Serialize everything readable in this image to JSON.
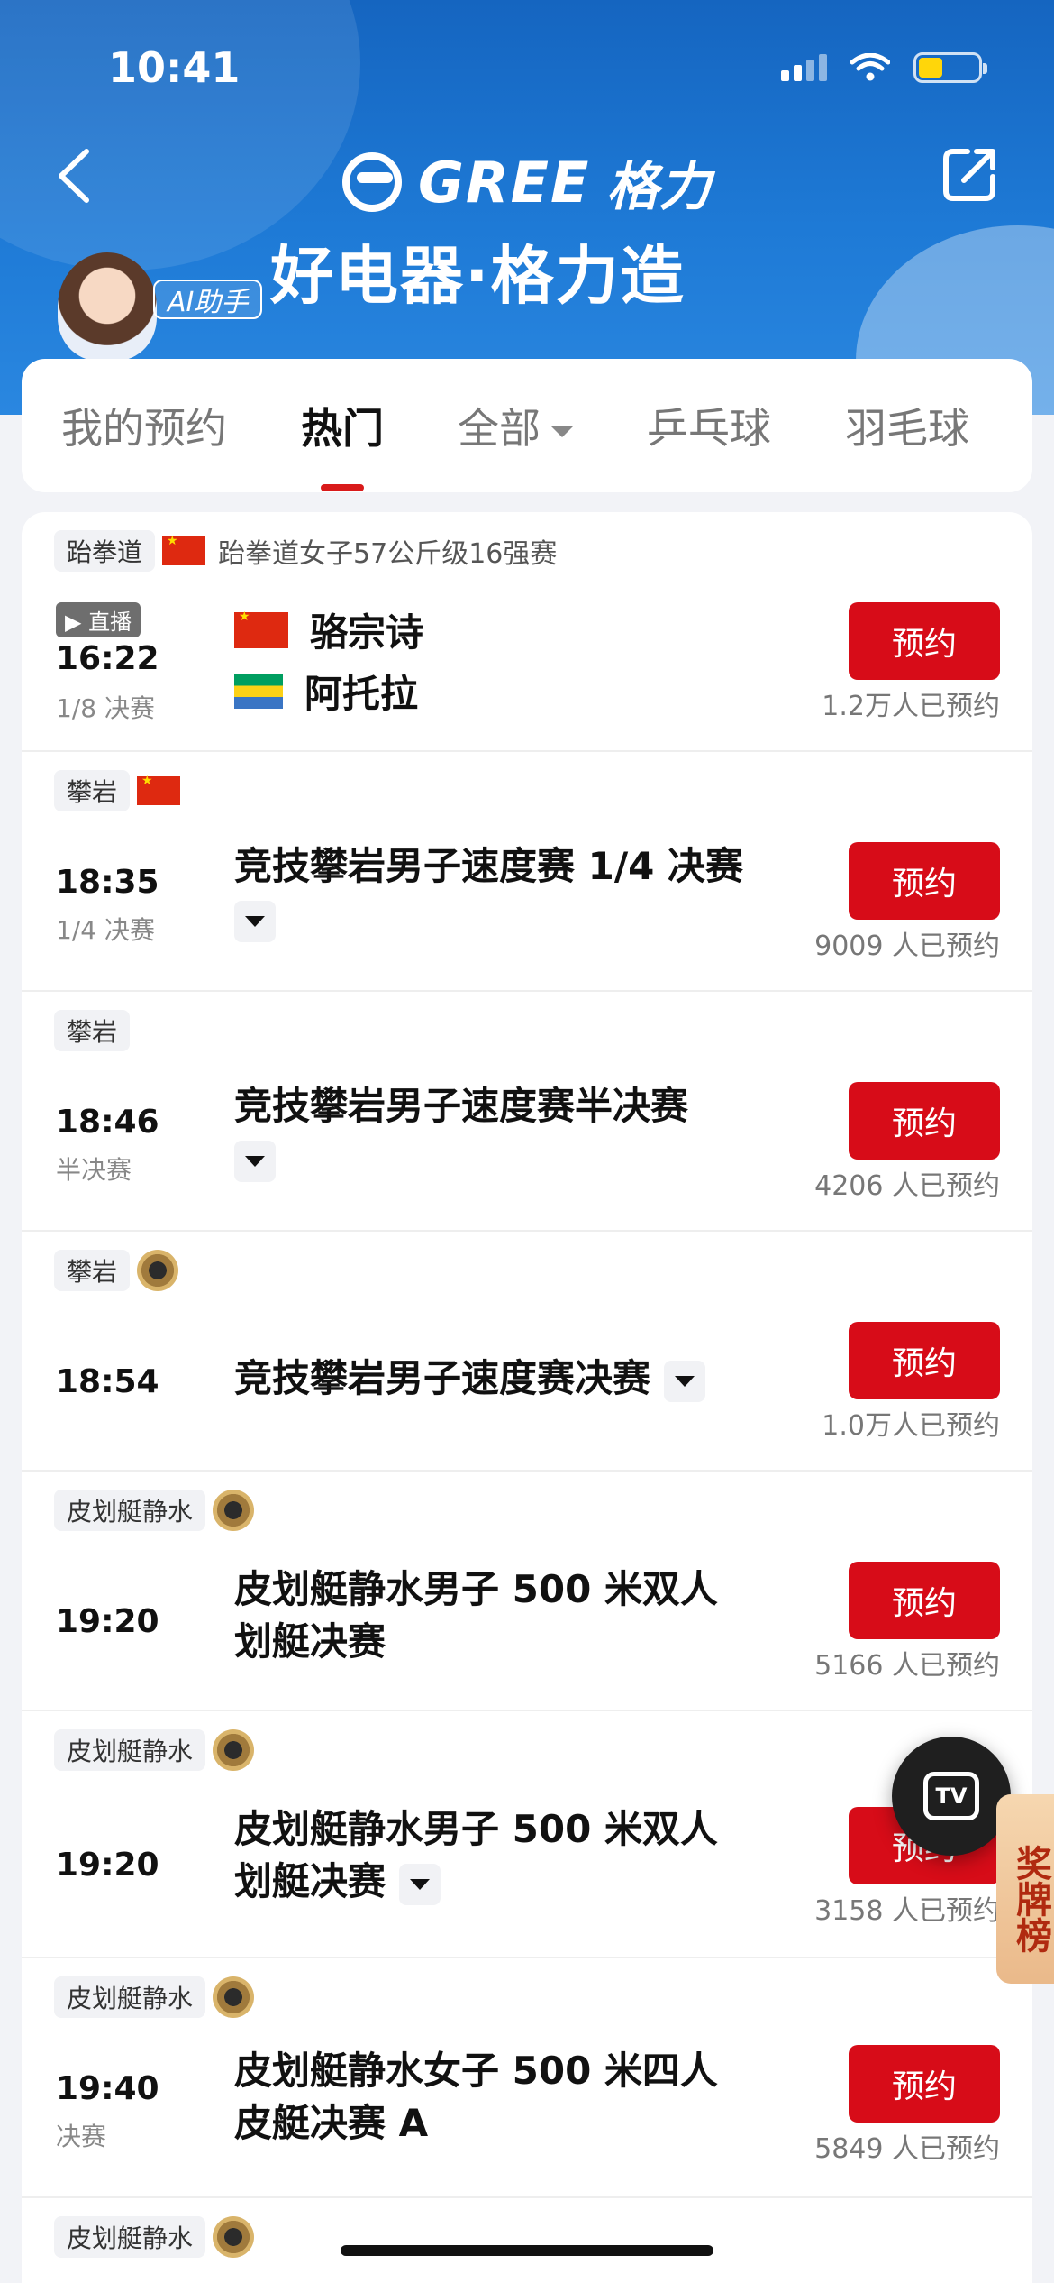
{
  "status": {
    "time": "10:41"
  },
  "header": {
    "brand_name": "GREE",
    "brand_cn": "格力",
    "slogan": "好电器·格力造",
    "ai_badge": "AI助手"
  },
  "tabs": [
    {
      "label": "我的预约",
      "active": false
    },
    {
      "label": "热门",
      "active": true
    },
    {
      "label": "全部",
      "active": false,
      "dropdown": true
    },
    {
      "label": "乒乓球",
      "active": false
    },
    {
      "label": "羽毛球",
      "active": false
    }
  ],
  "events": [
    {
      "sport": "跆拳道",
      "head_title": "跆拳道女子57公斤级16强赛",
      "live_label": "直播",
      "time": "16:22",
      "round": "1/8 决赛",
      "players": [
        "骆宗诗",
        "阿托拉"
      ],
      "button": "预约",
      "count": "1.2万人已预约"
    },
    {
      "sport": "攀岩",
      "time": "18:35",
      "round": "1/4 决赛",
      "title": "竞技攀岩男子速度赛 1/4 决赛",
      "button": "预约",
      "count": "9009 人已预约"
    },
    {
      "sport": "攀岩",
      "time": "18:46",
      "round": "半决赛",
      "title": "竞技攀岩男子速度赛半决赛",
      "button": "预约",
      "count": "4206 人已预约"
    },
    {
      "sport": "攀岩",
      "time": "18:54",
      "title": "竞技攀岩男子速度赛决赛",
      "button": "预约",
      "count": "1.0万人已预约"
    },
    {
      "sport": "皮划艇静水",
      "time": "19:20",
      "title": "皮划艇静水男子 500 米双人划艇决赛",
      "button": "预约",
      "count": "5166 人已预约"
    },
    {
      "sport": "皮划艇静水",
      "time": "19:20",
      "title": "皮划艇静水男子 500 米双人划艇决赛",
      "button": "预约",
      "count": "3158 人已预约"
    },
    {
      "sport": "皮划艇静水",
      "time": "19:40",
      "round": "决赛",
      "title": "皮划艇静水女子 500 米四人皮艇决赛 A",
      "button": "预约",
      "count": "5849 人已预约"
    },
    {
      "sport": "皮划艇静水"
    }
  ],
  "floats": {
    "tv_label": "TV",
    "medal_board": "奖牌榜"
  },
  "colors": {
    "header_blue": "#1e7ad6",
    "accent_red": "#d70c18",
    "tab_indicator": "#d91a1a"
  }
}
